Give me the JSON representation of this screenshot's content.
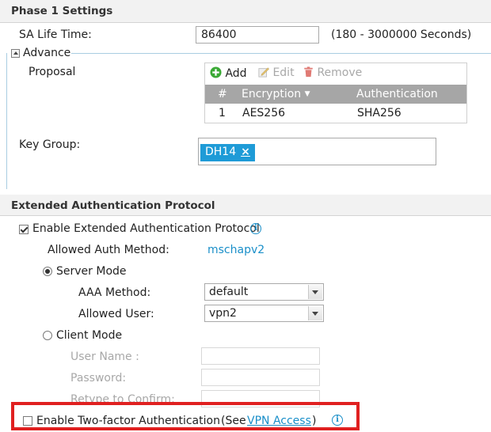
{
  "phase1": {
    "header": "Phase 1 Settings",
    "sa_life_time_label": "SA Life Time:",
    "sa_life_time_value": "86400",
    "sa_life_time_hint": "(180 - 3000000 Seconds)"
  },
  "advance": {
    "legend": "Advance",
    "proposal_label": "Proposal",
    "toolbar": {
      "add": "Add",
      "edit": "Edit",
      "remove": "Remove"
    },
    "table": {
      "headers": {
        "index": "#",
        "encryption": "Encryption",
        "authentication": "Authentication"
      },
      "rows": [
        {
          "index": "1",
          "encryption": "AES256",
          "authentication": "SHA256"
        }
      ]
    },
    "key_group_label": "Key Group:",
    "key_group_tag": "DH14",
    "key_group_tag_remove": "×"
  },
  "xauth": {
    "header": "Extended Authentication Protocol",
    "enable_label": "Enable Extended Authentication Protocol",
    "enable_checked": true,
    "allowed_auth_method_label": "Allowed Auth Method:",
    "allowed_auth_method_value": "mschapv2",
    "server_mode_label": "Server Mode",
    "aaa_method_label": "AAA Method:",
    "aaa_method_value": "default",
    "allowed_user_label": "Allowed User:",
    "allowed_user_value": "vpn2",
    "client_mode_label": "Client Mode",
    "user_name_label": "User Name :",
    "password_label": "Password:",
    "retype_label": "Retype to Confirm:",
    "two_factor_label": "Enable Two-factor Authentication",
    "two_factor_see_prefix": "(See",
    "two_factor_link": "VPN Access",
    "two_factor_see_suffix": ")"
  },
  "colors": {
    "accent": "#1a8fc9",
    "highlight": "#e02020",
    "add_icon": "#3aa935",
    "remove_icon": "#d9534f"
  }
}
